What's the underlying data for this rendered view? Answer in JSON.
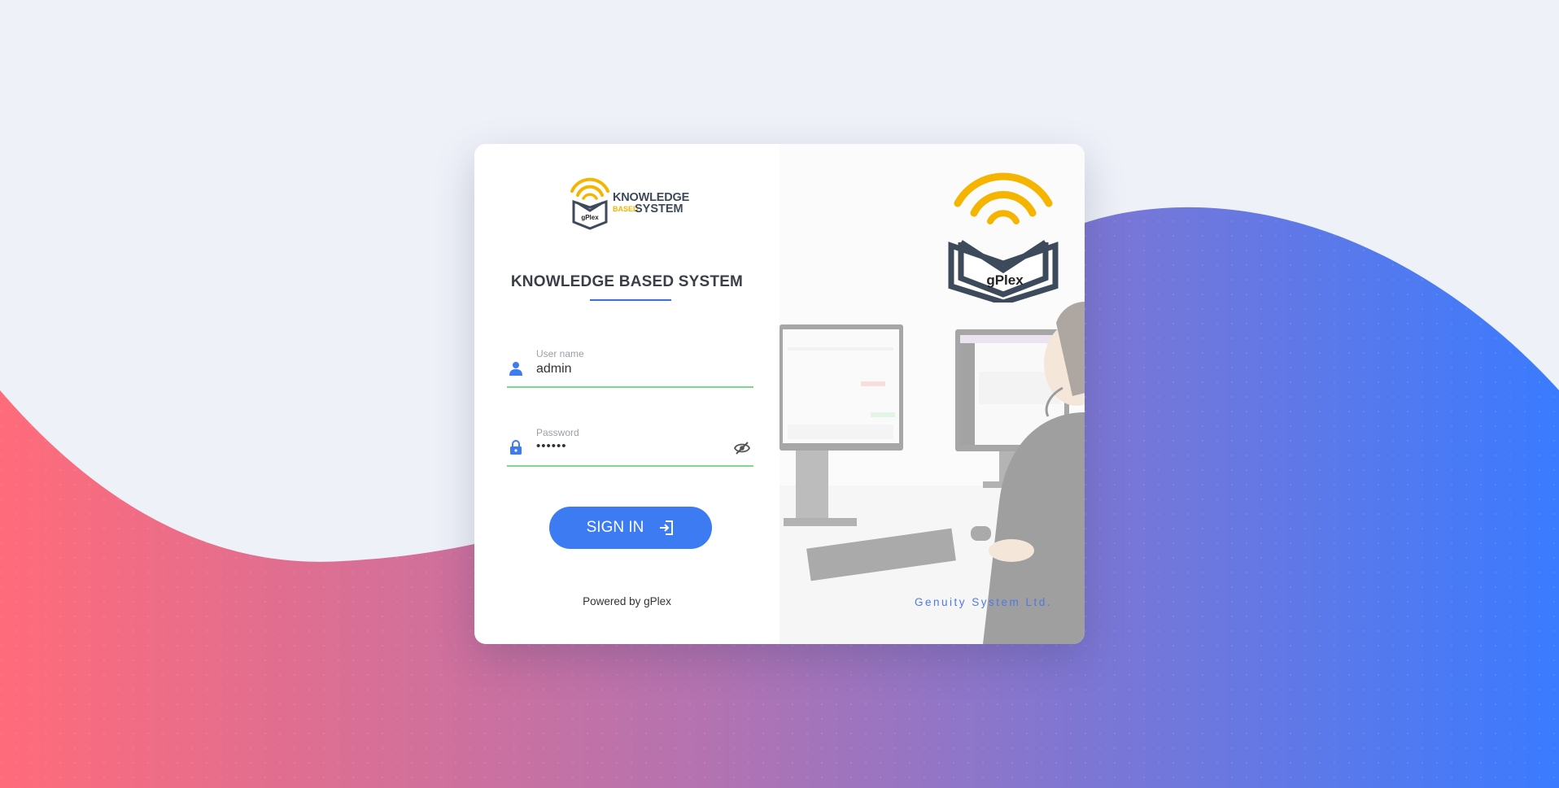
{
  "brand": {
    "logo_small_line1": "KNOWLEDGE",
    "logo_small_line2": "BASED",
    "logo_small_line3": "SYSTEM",
    "logo_badge": "gPlex"
  },
  "page_title": "KNOWLEDGE BASED SYSTEM",
  "form": {
    "username_label": "User name",
    "username_value": "admin",
    "password_label": "Password",
    "password_value": "••••••",
    "signin_label": "SIGN IN"
  },
  "footer": {
    "powered_by": "Powered by gPlex",
    "company": "Genuity System Ltd."
  },
  "colors": {
    "accent": "#3d7bf2",
    "wave_left": "#ff6b7a",
    "wave_right": "#3a7bff",
    "field_underline": "#7dd88a",
    "logo_yellow": "#f5b400",
    "logo_slate": "#3d4a5c"
  },
  "icons": {
    "user": "user-icon",
    "lock": "lock-icon",
    "eye_off": "eye-off-icon",
    "sign_in": "sign-in-icon"
  }
}
